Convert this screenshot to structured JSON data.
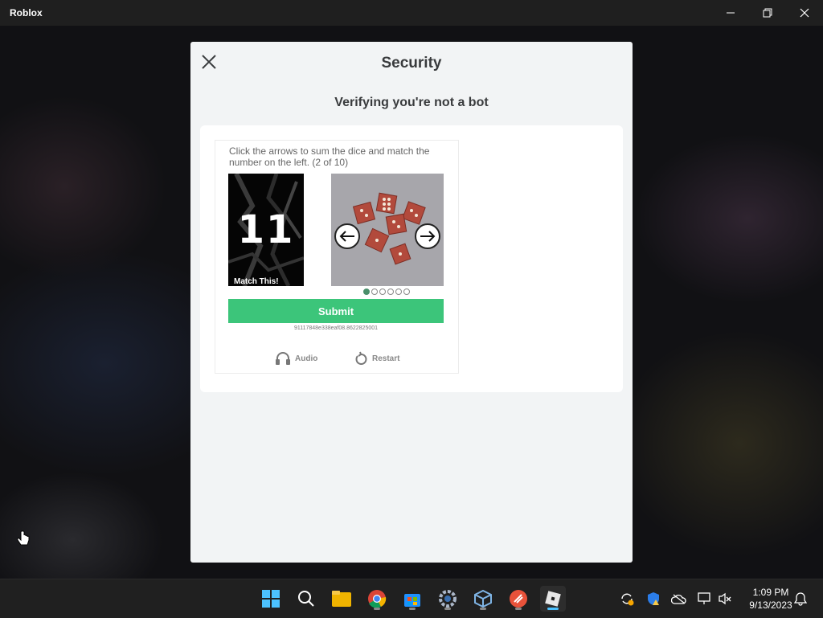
{
  "window": {
    "title": "Roblox"
  },
  "modal": {
    "title": "Security",
    "subtitle": "Verifying you're not a bot"
  },
  "captcha": {
    "instructions": "Click the arrows to sum the dice and match the number on the left. (2 of 10)",
    "target_number": "11",
    "target_caption": "Match This!",
    "progress_total_dots": 6,
    "progress_active_index": 0,
    "submit_label": "Submit",
    "session_id": "91117848e338eaf08.8622825001",
    "audio_label": "Audio",
    "restart_label": "Restart",
    "submit_color": "#3cc57a"
  },
  "taskbar": {
    "icons": [
      "windows-start-icon",
      "search-icon",
      "file-explorer-icon",
      "chrome-icon",
      "microsoft-store-icon",
      "settings-icon",
      "virtualbox-icon",
      "app-icon",
      "roblox-icon"
    ],
    "clock": {
      "time": "1:09 PM",
      "date": "9/13/2023"
    }
  }
}
